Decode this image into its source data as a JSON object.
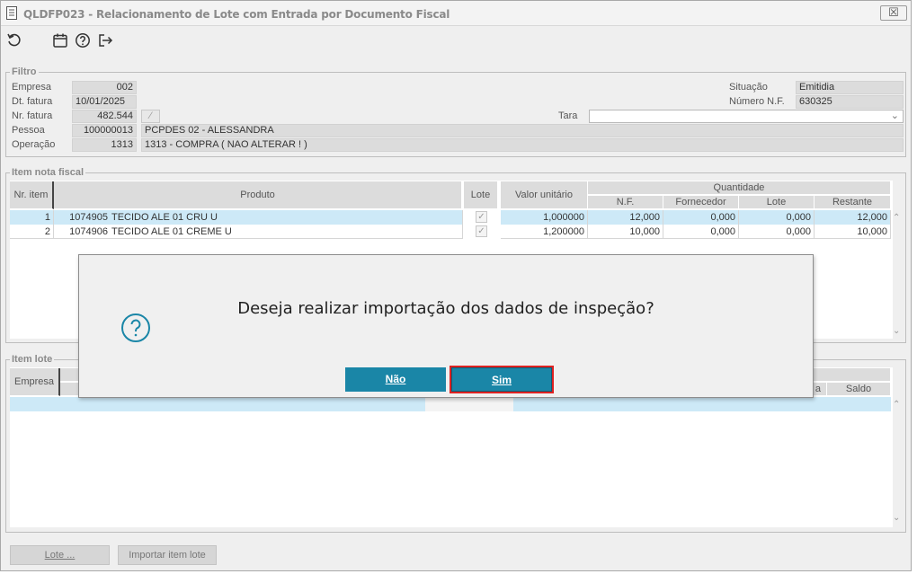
{
  "window": {
    "title": "QLDFP023 - Relacionamento de Lote com Entrada por Documento Fiscal",
    "close_label": "☒"
  },
  "toolbar": {
    "icons": [
      "refresh-icon",
      "calendar-icon",
      "help-icon",
      "exit-icon"
    ]
  },
  "filtro": {
    "legend": "Filtro",
    "empresa_label": "Empresa",
    "empresa_value": "002",
    "dt_fatura_label": "Dt. fatura",
    "dt_fatura_value": "10/01/2025",
    "nr_fatura_label": "Nr. fatura",
    "nr_fatura_value": "482.544",
    "pessoa_label": "Pessoa",
    "pessoa_code": "100000013",
    "pessoa_name": "PCPDES 02 - ALESSANDRA",
    "operacao_label": "Operação",
    "operacao_code": "1313",
    "operacao_name": "1313 - COMPRA ( NAO ALTERAR ! )",
    "situacao_label": "Situação",
    "situacao_value": "Emitidia",
    "numero_nf_label": "Número N.F.",
    "numero_nf_value": "630325",
    "tara_label": "Tara",
    "tara_value": ""
  },
  "item_nota": {
    "legend": "Item nota fiscal",
    "headers": {
      "nr_item": "Nr. item",
      "produto": "Produto",
      "lote": "Lote",
      "valor_unitario": "Valor unitário",
      "quantidade": "Quantidade",
      "nf": "N.F.",
      "fornecedor": "Fornecedor",
      "q_lote": "Lote",
      "restante": "Restante"
    },
    "rows": [
      {
        "nr": "1",
        "codigo": "1074905",
        "produto": "TECIDO ALE 01 CRU U",
        "valor": "1,000000",
        "nf": "12,000",
        "fornecedor": "0,000",
        "lote": "0,000",
        "restante": "12,000"
      },
      {
        "nr": "2",
        "codigo": "1074906",
        "produto": "TECIDO ALE 01 CREME U",
        "valor": "1,200000",
        "nf": "10,000",
        "fornecedor": "0,000",
        "lote": "0,000",
        "restante": "10,000"
      }
    ]
  },
  "item_lote": {
    "legend": "Item lote",
    "headers": {
      "empresa": "Empresa",
      "partial": "a",
      "saldo": "Saldo"
    }
  },
  "buttons": {
    "lote": "Lote ...",
    "importar": "Importar item lote"
  },
  "dialog": {
    "message": "Deseja realizar importação dos dados de inspeção?",
    "nao": "Não",
    "sim": "Sim"
  },
  "colors": {
    "accent": "#1a86a7",
    "selection": "#cde9f7",
    "focus_outline": "#dd2222"
  }
}
